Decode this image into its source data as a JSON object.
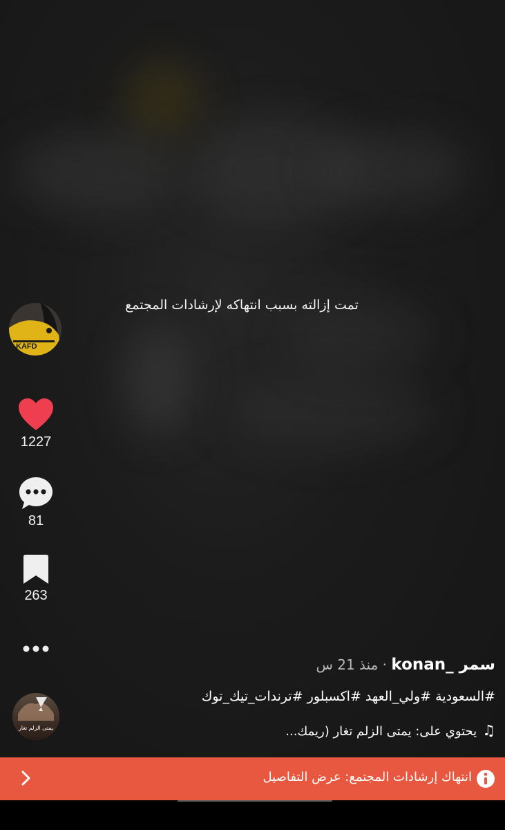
{
  "video": {
    "removed_message": "تمت إزالته بسبب انتهاكه لإرشادات المجتمع"
  },
  "actions": {
    "likes": "1227",
    "comments": "81",
    "saves": "263"
  },
  "post": {
    "author": "سمر _konan",
    "separator": " · ",
    "time_ago": "منذ 21 س",
    "caption": "#السعودية #ولي_العهد #اكسبلور #ترندات_تيك_توك",
    "music": "يحتوي على: يمتى الزلم تغار (ريمك..."
  },
  "sound_disc": {
    "label": "يمتى الزلم تغار"
  },
  "banner": {
    "text": "انتهاك إرشادات المجتمع: عرض التفاصيل"
  },
  "colors": {
    "banner": "#e8573f",
    "like": "#ef3e4f"
  },
  "icons": [
    "heart-icon",
    "comment-icon",
    "bookmark-icon",
    "more-icon",
    "music-note-icon",
    "info-icon",
    "chevron-right-icon"
  ]
}
